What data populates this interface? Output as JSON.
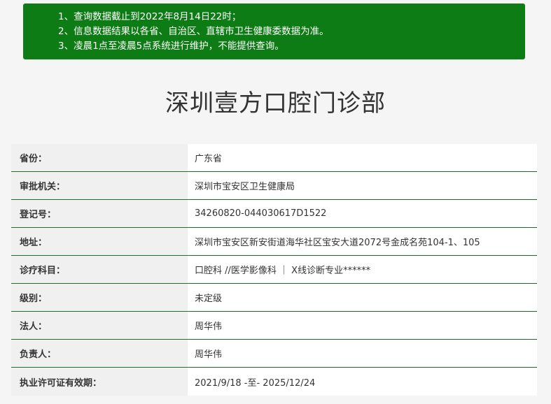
{
  "notice": {
    "lines": [
      "1、查询数据截止到2022年8月14日22时；",
      "2、信息数据结果以各省、自治区、直辖市卫生健康委数据为准。",
      "3、凌晨1点至凌晨5点系统进行维护，不能提供查询。"
    ]
  },
  "title": "深圳壹方口腔门诊部",
  "rows": [
    {
      "label": "省份：",
      "value": "广东省"
    },
    {
      "label": "审批机关：",
      "value": "深圳市宝安区卫生健康局"
    },
    {
      "label": "登记号：",
      "value": "34260820-044030617D1522"
    },
    {
      "label": "地址：",
      "value": "深圳市宝安区新安街道海华社区宝安大道2072号金成名苑104-1、105"
    },
    {
      "label": "诊疗科目：",
      "value": "口腔科 //医学影像科 ｜ X线诊断专业******"
    },
    {
      "label": "级别：",
      "value": "未定级"
    },
    {
      "label": "法人：",
      "value": "周华伟"
    },
    {
      "label": "负责人：",
      "value": "周华伟"
    },
    {
      "label": "执业许可证有效期：",
      "value": "2021/9/18 -至- 2025/12/24"
    }
  ],
  "colors": {
    "notice_bg": "#0e7c15",
    "row_border": "#1d6e28"
  }
}
